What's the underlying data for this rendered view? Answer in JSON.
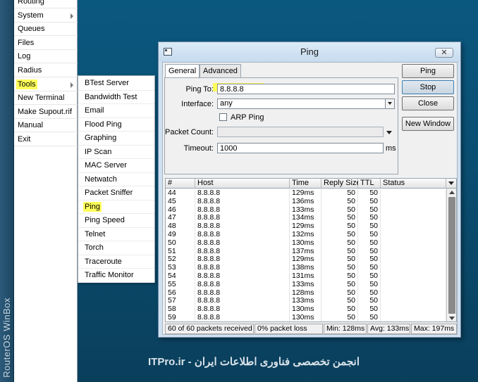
{
  "side_strip": {
    "text": "RouterOS WinBox"
  },
  "main_menu": {
    "items": [
      {
        "label": "Routing",
        "has_submenu": false
      },
      {
        "label": "System",
        "has_submenu": true
      },
      {
        "label": "Queues",
        "has_submenu": false
      },
      {
        "label": "Files",
        "has_submenu": false
      },
      {
        "label": "Log",
        "has_submenu": false
      },
      {
        "label": "Radius",
        "has_submenu": false
      },
      {
        "label": "Tools",
        "has_submenu": true
      },
      {
        "label": "New Terminal",
        "has_submenu": false
      },
      {
        "label": "Make Supout.rif",
        "has_submenu": false
      },
      {
        "label": "Manual",
        "has_submenu": false
      },
      {
        "label": "Exit",
        "has_submenu": false
      }
    ]
  },
  "tools_menu": {
    "items": [
      "BTest Server",
      "Bandwidth Test",
      "Email",
      "Flood Ping",
      "Graphing",
      "IP Scan",
      "MAC Server",
      "Netwatch",
      "Packet Sniffer",
      "Ping",
      "Ping Speed",
      "Telnet",
      "Torch",
      "Traceroute",
      "Traffic Monitor"
    ]
  },
  "ping_window": {
    "title": "Ping",
    "close_label": "✕",
    "tabs": [
      {
        "label": "General",
        "active": true
      },
      {
        "label": "Advanced",
        "active": false
      }
    ],
    "form": {
      "ping_to_label": "Ping To:",
      "ping_to_value": "8.8.8.8",
      "interface_label": "Interface:",
      "interface_value": "any",
      "arp_ping_label": "ARP Ping",
      "packet_count_label": "Packet Count:",
      "packet_count_value": "",
      "timeout_label": "Timeout:",
      "timeout_value": "1000",
      "timeout_unit": "ms"
    },
    "buttons": {
      "ping": "Ping",
      "stop": "Stop",
      "close": "Close",
      "new_window": "New Window"
    },
    "table": {
      "columns": [
        "#",
        "Host",
        "Time",
        "Reply Size",
        "TTL",
        "Status"
      ],
      "rows": [
        [
          "44",
          "8.8.8.8",
          "129ms",
          "50",
          "50",
          ""
        ],
        [
          "45",
          "8.8.8.8",
          "136ms",
          "50",
          "50",
          ""
        ],
        [
          "46",
          "8.8.8.8",
          "133ms",
          "50",
          "50",
          ""
        ],
        [
          "47",
          "8.8.8.8",
          "134ms",
          "50",
          "50",
          ""
        ],
        [
          "48",
          "8.8.8.8",
          "129ms",
          "50",
          "50",
          ""
        ],
        [
          "49",
          "8.8.8.8",
          "132ms",
          "50",
          "50",
          ""
        ],
        [
          "50",
          "8.8.8.8",
          "130ms",
          "50",
          "50",
          ""
        ],
        [
          "51",
          "8.8.8.8",
          "137ms",
          "50",
          "50",
          ""
        ],
        [
          "52",
          "8.8.8.8",
          "129ms",
          "50",
          "50",
          ""
        ],
        [
          "53",
          "8.8.8.8",
          "138ms",
          "50",
          "50",
          ""
        ],
        [
          "54",
          "8.8.8.8",
          "131ms",
          "50",
          "50",
          ""
        ],
        [
          "55",
          "8.8.8.8",
          "133ms",
          "50",
          "50",
          ""
        ],
        [
          "56",
          "8.8.8.8",
          "128ms",
          "50",
          "50",
          ""
        ],
        [
          "57",
          "8.8.8.8",
          "133ms",
          "50",
          "50",
          ""
        ],
        [
          "58",
          "8.8.8.8",
          "130ms",
          "50",
          "50",
          ""
        ],
        [
          "59",
          "8.8.8.8",
          "130ms",
          "50",
          "50",
          ""
        ]
      ]
    },
    "status": {
      "received": "60 of 60 packets received",
      "loss": "0% packet loss",
      "min": "Min: 128ms",
      "avg": "Avg: 133ms",
      "max": "Max: 197ms"
    }
  },
  "watermark": "ITPro.ir - انجمن تخصصی فناوری اطلاعات ایران",
  "colors": {
    "highlight": "#ffff59",
    "desktop": "#0b4e74",
    "window_frame": "#cfe1f1"
  }
}
